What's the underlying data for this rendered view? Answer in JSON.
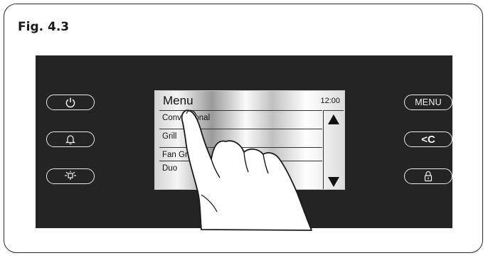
{
  "figure": {
    "label": "Fig. 4.3"
  },
  "left_buttons": [
    {
      "icon": "power-icon"
    },
    {
      "icon": "bell-icon"
    },
    {
      "icon": "oven-light-icon"
    }
  ],
  "right_buttons": [
    {
      "label": "MENU"
    },
    {
      "label": "<C",
      "icon": "back-arrow-icon"
    },
    {
      "icon": "lock-icon"
    }
  ],
  "screen": {
    "title": "Menu",
    "time": "12:00",
    "items": [
      "Conventional",
      "Grill",
      "Fan Grill",
      "Duo"
    ],
    "scroll_up_icon": "triangle-up-icon",
    "scroll_down_icon": "triangle-down-icon"
  },
  "overlay": {
    "icon": "pointing-hand-icon"
  }
}
